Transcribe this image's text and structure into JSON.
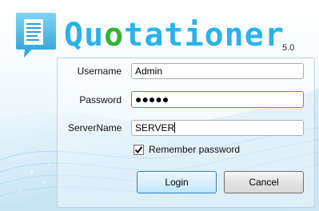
{
  "header": {
    "brand_part1": "Qu",
    "brand_part2": "o",
    "brand_part3": "tationer",
    "version": "5.0",
    "logo_icon": "document-chat-icon"
  },
  "form": {
    "username_label": "Username",
    "username_value": "Admin",
    "password_label": "Password",
    "password_masked": "●●●●●",
    "server_label": "ServerName",
    "server_value": "SERVER",
    "remember_label": "Remember password",
    "remember_checked": true
  },
  "buttons": {
    "login_label": "Login",
    "cancel_label": "Cancel"
  },
  "colors": {
    "brand_blue": "#2bb3e6",
    "brand_green": "#34b233",
    "focus_border": "#3d8fd6"
  }
}
